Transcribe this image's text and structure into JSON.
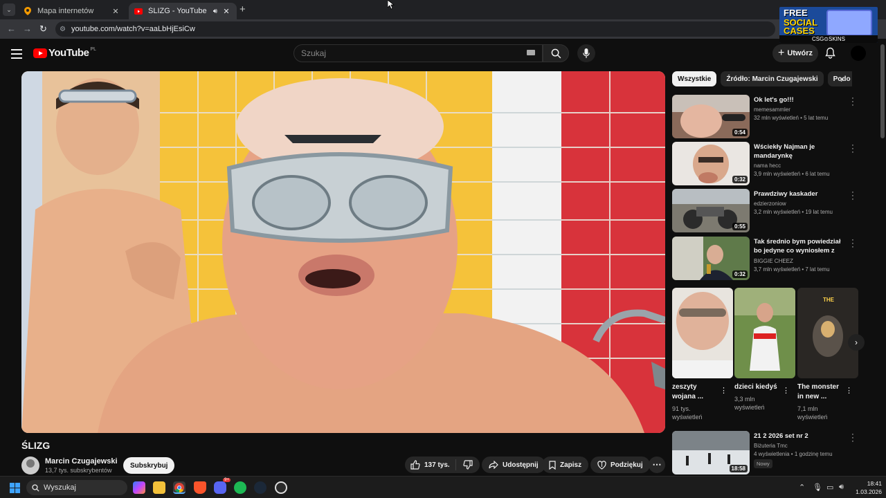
{
  "browser": {
    "tabs": [
      {
        "title": "Mapa internetów",
        "icon": "map-pin-icon"
      },
      {
        "title": "ŚLIZG - YouTube",
        "icon": "youtube-icon",
        "audio": true,
        "active": true
      }
    ],
    "url": "youtube.com/watch?v=aaLbHjEsiCw",
    "ad": {
      "line1": "FREE",
      "line2": "SOCIAL",
      "line3": "CASES",
      "footer": "CSG⊙SKINS"
    }
  },
  "masthead": {
    "logo": "YouTube",
    "country": "PL",
    "search_placeholder": "Szukaj",
    "create_label": "Utwórz"
  },
  "video": {
    "title": "ŚLIZG",
    "channel": "Marcin Czugajewski",
    "subscribers": "13,7 tys. subskrybentów",
    "subscribe_label": "Subskrybuj",
    "likes": "137 tys.",
    "share_label": "Udostępnij",
    "save_label": "Zapisz",
    "thanks_label": "Podziękuj"
  },
  "chips": [
    "Wszystkie",
    "Źródło: Marcin Czugajewski",
    "Podo"
  ],
  "recommendations": [
    {
      "title": "Ok let's go!!!",
      "channel": "memesammler",
      "meta": "32 mln wyświetleń • 5 lat temu",
      "duration": "0:54"
    },
    {
      "title": "Wściekły Najman je mandarynkę",
      "channel": "nama hecc",
      "meta": "3,9 mln wyświetleń • 6 lat temu",
      "duration": "0:32"
    },
    {
      "title": "Prawdziwy kaskader",
      "channel": "edzierzoniow",
      "meta": "3,2 mln wyświetleń • 19 lat temu",
      "duration": "0:55"
    },
    {
      "title": "Tak średnio bym powiedział bo jedyne co wyniosłem z tego ...",
      "channel": "BIGGIE CHEEZ",
      "meta": "3,7 mln wyświetleń • 7 lat temu",
      "duration": "0:32"
    }
  ],
  "shorts": [
    {
      "title": "zeszyty wojana ...",
      "views": "91 tys. wyświetleń"
    },
    {
      "title": "dzieci kiedyś",
      "views": "3,3 mln wyświetleń"
    },
    {
      "title": "The monster in new ...",
      "views": "7,1 mln wyświetleń",
      "thumb_text": "THE"
    }
  ],
  "rec_bottom": {
    "title": "21 2 2026 set nr 2",
    "channel": "Biżuteria Tmc",
    "meta": "4 wyświetlenia • 1 godzinę temu",
    "badge": "Nowy",
    "duration": "18:58"
  },
  "taskbar": {
    "search_label": "Wyszukaj",
    "time": "18:41",
    "date": "1.03.2026",
    "discord_badge": "9+"
  }
}
